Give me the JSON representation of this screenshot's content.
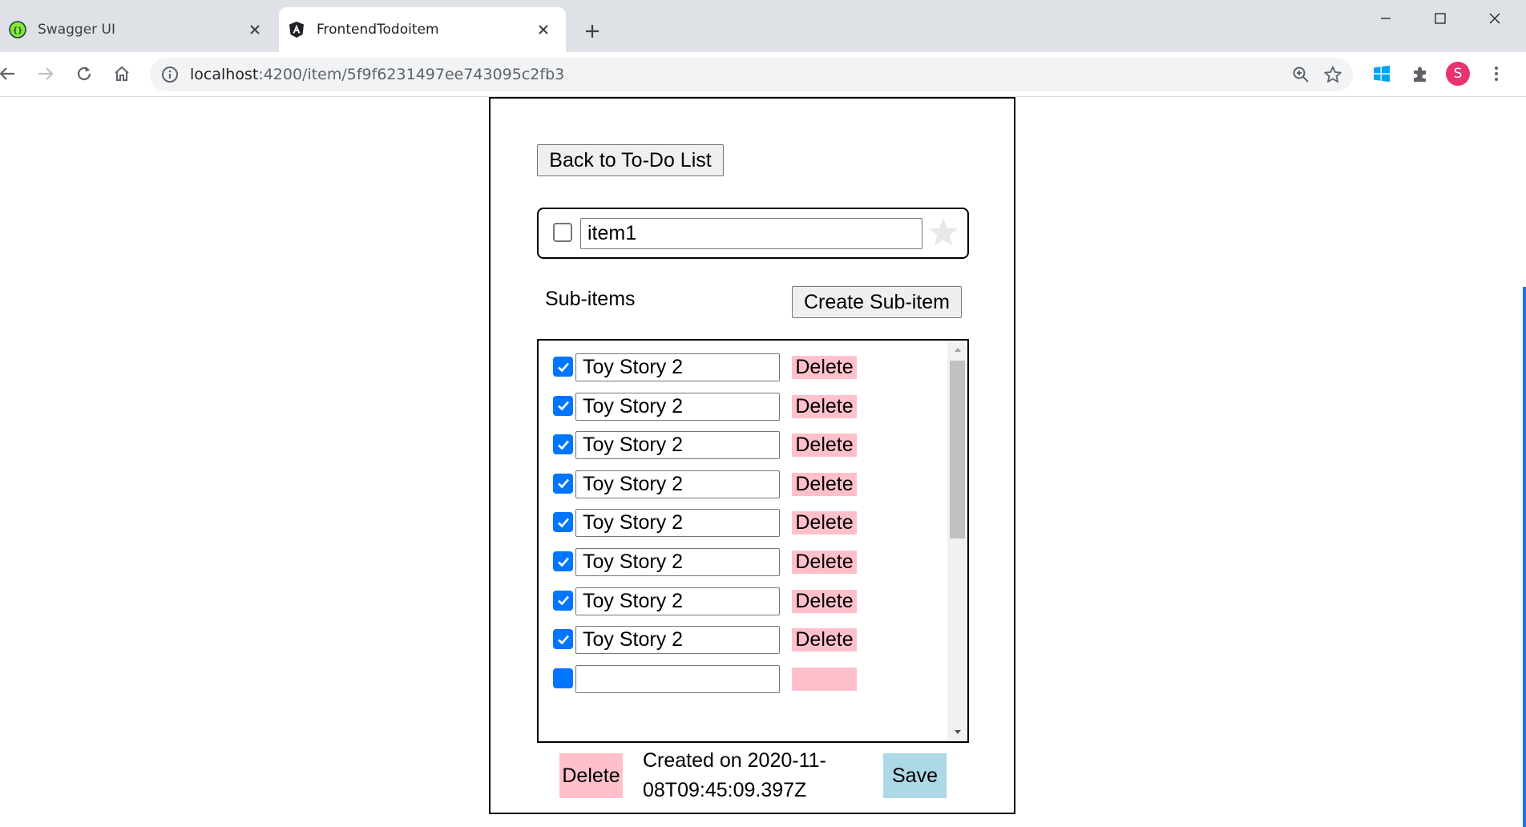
{
  "browser": {
    "tabs": [
      {
        "title": "Swagger UI",
        "active": false,
        "favicon": "swagger-icon"
      },
      {
        "title": "FrontendTodoitem",
        "active": true,
        "favicon": "angular-icon"
      }
    ],
    "url_host": "localhost",
    "url_path": ":4200/item/5f9f6231497ee743095c2fb3",
    "profile_initial": "S",
    "colors": {
      "profile": "#e8336e",
      "accent": "#1a73e8"
    }
  },
  "page": {
    "back_button": "Back to To-Do List",
    "item": {
      "done": false,
      "name": "item1",
      "starred": false
    },
    "subitems_label": "Sub-items",
    "create_subitem_button": "Create Sub-item",
    "subitems": [
      {
        "done": true,
        "name": "Toy Story 2",
        "delete_label": "Delete"
      },
      {
        "done": true,
        "name": "Toy Story 2",
        "delete_label": "Delete"
      },
      {
        "done": true,
        "name": "Toy Story 2",
        "delete_label": "Delete"
      },
      {
        "done": true,
        "name": "Toy Story 2",
        "delete_label": "Delete"
      },
      {
        "done": true,
        "name": "Toy Story 2",
        "delete_label": "Delete"
      },
      {
        "done": true,
        "name": "Toy Story 2",
        "delete_label": "Delete"
      },
      {
        "done": true,
        "name": "Toy Story 2",
        "delete_label": "Delete"
      },
      {
        "done": true,
        "name": "Toy Story 2",
        "delete_label": "Delete"
      }
    ],
    "delete_button": "Delete",
    "created_text": "Created on 2020-11-08T09:45:09.397Z",
    "save_button": "Save",
    "colors": {
      "delete": "#ffc0cb",
      "save": "#add8e6",
      "checkbox": "#0075ff"
    }
  }
}
